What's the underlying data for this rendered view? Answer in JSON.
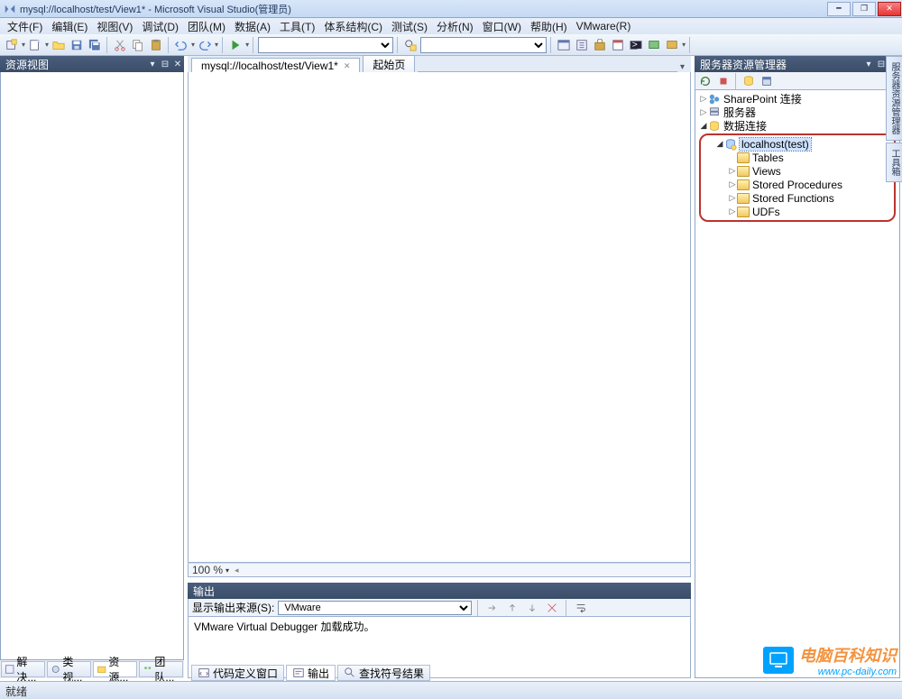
{
  "title": "mysql://localhost/test/View1* - Microsoft Visual Studio(管理员)",
  "menu": [
    "文件(F)",
    "编辑(E)",
    "视图(V)",
    "调试(D)",
    "团队(M)",
    "数据(A)",
    "工具(T)",
    "体系结构(C)",
    "测试(S)",
    "分析(N)",
    "窗口(W)",
    "帮助(H)",
    "VMware(R)"
  ],
  "left_panel": {
    "title": "资源视图",
    "tabs": [
      "解决...",
      "类视...",
      "资源...",
      "团队..."
    ],
    "active_tab": 2
  },
  "doc_tabs": [
    {
      "label": "mysql://localhost/test/View1*",
      "active": true
    },
    {
      "label": "起始页",
      "active": false
    }
  ],
  "zoom": "100 %",
  "output": {
    "title": "输出",
    "source_label": "显示输出来源(S):",
    "source_value": "VMware",
    "body": "VMware Virtual Debugger 加载成功。"
  },
  "right_panel": {
    "title": "服务器资源管理器",
    "roots": [
      {
        "label": "SharePoint 连接",
        "kind": "sp"
      },
      {
        "label": "服务器",
        "kind": "srv"
      },
      {
        "label": "数据连接",
        "kind": "db",
        "expanded": true
      }
    ],
    "db_node": "localhost(test)",
    "db_children": [
      "Tables",
      "Views",
      "Stored Procedures",
      "Stored Functions",
      "UDFs"
    ]
  },
  "bottom_tabs": [
    {
      "label": "代码定义窗口",
      "icon": "code"
    },
    {
      "label": "输出",
      "icon": "out",
      "active": true
    },
    {
      "label": "查找符号结果",
      "icon": "find"
    }
  ],
  "side_tabs": [
    "服务器资源管理器",
    "工具箱"
  ],
  "status": "就绪",
  "watermark": {
    "brand": "电脑百科知识",
    "url": "www.pc-daily.com"
  }
}
